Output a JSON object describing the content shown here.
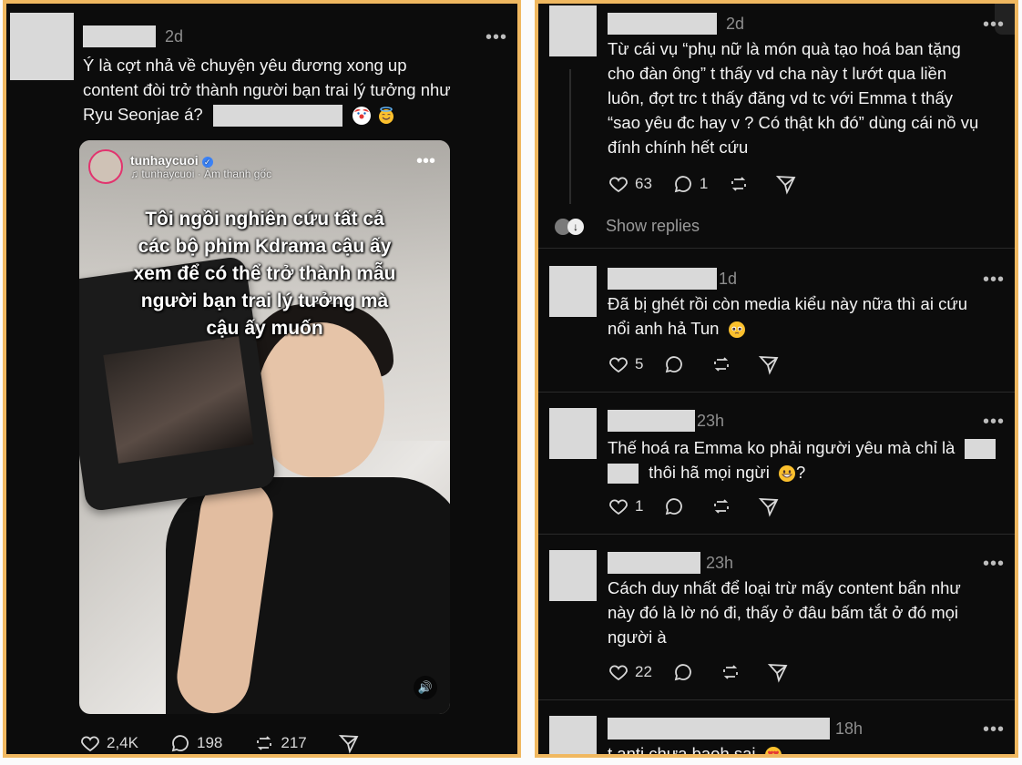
{
  "left_post": {
    "time": "2d",
    "text_line1": "Ý là cợt nhả về chuyện yêu đương xong up",
    "text_line2": "content đòi trở thành người bạn trai lý tưởng như",
    "text_line3": "Ryu Seonjae á?",
    "video": {
      "username": "tunhaycuoi",
      "sound": "tunhaycuoi · Âm thanh gốc",
      "caption_lines": [
        "Tôi ngồi nghiên cứu tất cả",
        "các bộ phim Kdrama cậu ấy",
        "xem để có thể trở thành mẫu",
        "người bạn trai lý tưởng mà",
        "cậu ấy muốn"
      ]
    },
    "likes": "2,4K",
    "comments": "198",
    "reposts": "217"
  },
  "right_comments": [
    {
      "time": "2d",
      "lines": [
        "Từ cái vụ “phụ nữ là món quà tạo hoá ban tặng",
        "cho đàn ông” t thấy vd cha này t lướt qua liền",
        "luôn, đợt trc t thấy đăng vd tc với Emma t thấy",
        "“sao yêu đc hay v ? Có thật kh đó” dùng cái nồ vụ",
        "đính chính hết cứu"
      ],
      "likes": "63",
      "comments": "1",
      "show_replies": "Show replies"
    },
    {
      "time": "1d",
      "line1": "Đã bị ghét rồi còn media kiểu này nữa thì ai cứu",
      "line2": "nổi anh hả Tun",
      "likes": "5"
    },
    {
      "time": "23h",
      "line1": "Thế hoá ra Emma ko phải người yêu mà chỉ là",
      "line2": "thôi hã mọi ngừi",
      "line2_end": "?",
      "likes": "1"
    },
    {
      "time": "23h",
      "lines": [
        "Cách duy nhất để loại trừ mấy content bẩn như",
        "này đó là lờ nó đi, thấy ở đâu bấm tắt ở đó mọi",
        "người à"
      ],
      "likes": "22"
    },
    {
      "time": "18h",
      "line1": "t anti chưa baoh sai"
    }
  ],
  "colors": {
    "frame": "#f0b860",
    "bg": "#0c0c0c",
    "placeholder": "#d9d9d9"
  }
}
